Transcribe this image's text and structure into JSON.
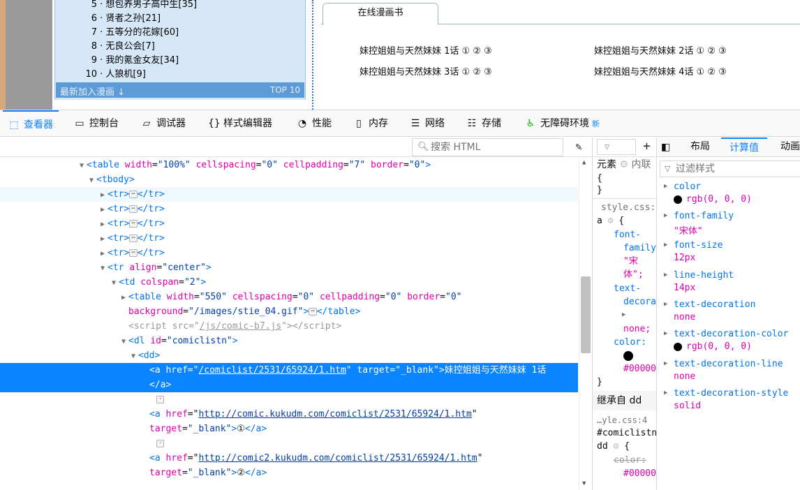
{
  "page": {
    "ranking": [
      {
        "num": "5",
        "title": "想包养男子高中生[35]"
      },
      {
        "num": "6",
        "title": "贤者之孙[21]"
      },
      {
        "num": "7",
        "title": "五等分的花嫁[60]"
      },
      {
        "num": "8",
        "title": "无良公会[7]"
      },
      {
        "num": "9",
        "title": "我的氪金女友[34]"
      },
      {
        "num": "10",
        "title": "人狼机[9]"
      }
    ],
    "footer_left": "最新加入漫画 ↓",
    "footer_right": "TOP 10",
    "tab_label": "在线漫画书",
    "episodes": [
      "妹控姐姐与天然妹妹 1话 ① ② ③",
      "妹控姐姐与天然妹妹 2话 ① ② ③",
      "妹控姐姐与天然妹妹 3话 ① ② ③",
      "妹控姐姐与天然妹妹 4话 ① ② ③"
    ]
  },
  "devtools": {
    "tabs": [
      {
        "icon": "inspector-icon",
        "glyph": "⬚",
        "label": "查看器"
      },
      {
        "icon": "console-icon",
        "glyph": "▭",
        "label": "控制台"
      },
      {
        "icon": "debugger-icon",
        "glyph": "▱",
        "label": "调试器"
      },
      {
        "icon": "style-editor-icon",
        "glyph": "{}",
        "label": "样式编辑器"
      },
      {
        "icon": "performance-icon",
        "glyph": "◔",
        "label": "性能"
      },
      {
        "icon": "memory-icon",
        "glyph": "▯",
        "label": "内存"
      },
      {
        "icon": "network-icon",
        "glyph": "☰",
        "label": "网络"
      },
      {
        "icon": "storage-icon",
        "glyph": "☷",
        "label": "存储"
      },
      {
        "icon": "accessibility-icon",
        "glyph": "♿",
        "label": "无障碍环境"
      }
    ],
    "new_badge": "新",
    "search_placeholder": "搜索 HTML",
    "markup": {
      "l1": {
        "tag": "table",
        "a1": "width",
        "v1": "\"100%\"",
        "a2": "cellspacing",
        "v2": "\"0\"",
        "a3": "cellpadding",
        "v3": "\"7\"",
        "a4": "border",
        "v4": "\"0\""
      },
      "tbody": "<tbody>",
      "tr": "<tr>",
      "tr_close": "</tr>",
      "tr_align": {
        "a": "align",
        "v": "\"center\""
      },
      "td": {
        "a": "colspan",
        "v": "\"2\""
      },
      "inner_table": {
        "a1": "width",
        "v1": "\"550\"",
        "a2": "cellspacing",
        "v2": "\"0\"",
        "a3": "cellpadding",
        "v3": "\"0\"",
        "a4": "border",
        "v4": "\"0\"",
        "a5": "background",
        "v5": "\"/images/stie_04.gif\""
      },
      "script": {
        "a": "src",
        "v": "/js/comic-b7.js"
      },
      "dl": {
        "a": "id",
        "v": "\"comiclistn\""
      },
      "dd": "<dd>",
      "a1": {
        "href": "/comiclist/2531/65924/1.htm",
        "target": "\"_blank\"",
        "text": "妹控姐姐与天然妹妹 1话"
      },
      "a2": {
        "href": "http://comic.kukudm.com/comiclist/2531/65924/1.htm",
        "target": "\"_blank\"",
        "text": "①"
      },
      "a3": {
        "href": "http://comic2.kukudm.com/comiclist/2531/65924/1.htm",
        "target": "\"_blank\"",
        "text": "②"
      }
    },
    "rules": {
      "filter_icon": "filter-icon",
      "element_label": "元素",
      "inline_label": "内联",
      "brace_open": "{",
      "brace_close": "}",
      "source1": "style.css:",
      "selector1": "a",
      "p_font_family": "font-",
      "p_font_family2": "family",
      "v_font_family": "\"宋",
      "v_font_family2": "体\";",
      "p_text_deco": "text-",
      "p_text_deco2": "decora",
      "v_none": "none;",
      "p_color": "color:",
      "v_color": "#00000",
      "inherit_label": "继承自 dd",
      "source2": "…yle.css:4",
      "selector2": "#comiclistn",
      "selector2b": "dd",
      "p_color2": "color:",
      "v_color2": "#00000"
    },
    "computed_tabs": [
      "布局",
      "计算值",
      "动画"
    ],
    "computed_filter": "过滤样式",
    "computed": [
      {
        "name": "color",
        "value": "rgb(0, 0, 0)",
        "swatch": true
      },
      {
        "name": "font-family",
        "value": "\"宋体\""
      },
      {
        "name": "font-size",
        "value": "12px"
      },
      {
        "name": "line-height",
        "value": "14px"
      },
      {
        "name": "text-decoration",
        "value": "none"
      },
      {
        "name": "text-decoration-color",
        "value": "rgb(0, 0, 0)",
        "swatch": true
      },
      {
        "name": "text-decoration-line",
        "value": "none"
      },
      {
        "name": "text-decoration-style",
        "value": "solid"
      }
    ]
  }
}
